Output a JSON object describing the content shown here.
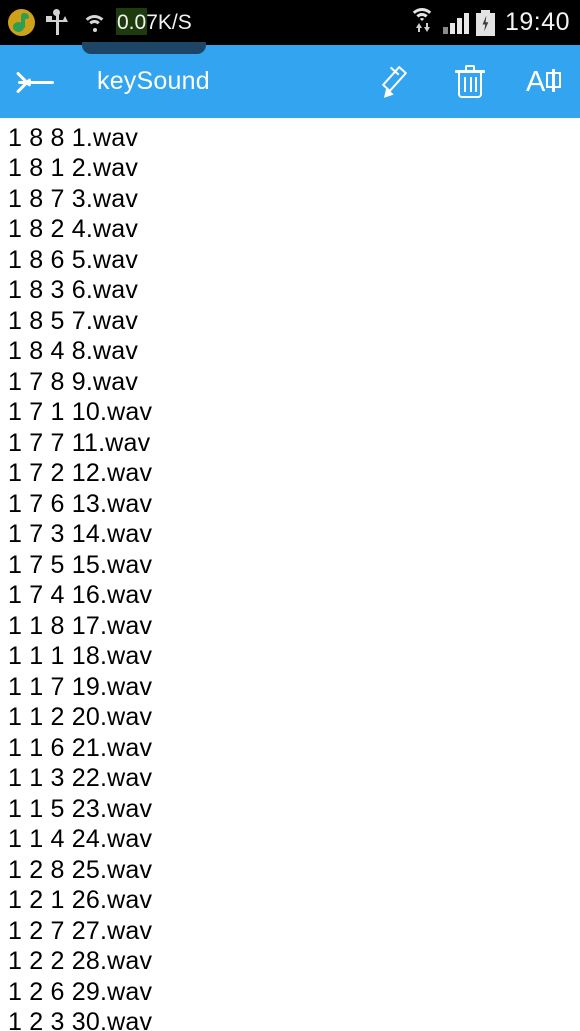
{
  "statusbar": {
    "network_speed": "0.07K/S",
    "clock": "19:40",
    "icons": [
      "music-note-icon",
      "usb-icon",
      "wifi-icon",
      "wifi-transfer-icon",
      "cellular-signal-icon",
      "battery-charging-icon"
    ]
  },
  "appbar": {
    "back_label": "back-arrow-icon",
    "title": "keySound",
    "actions": [
      {
        "name": "edit-icon",
        "label": "Edit"
      },
      {
        "name": "delete-icon",
        "label": "Delete"
      },
      {
        "name": "translate-icon",
        "label": "Translate"
      }
    ]
  },
  "filelist": {
    "rows": [
      "1 8 8 1.wav",
      "1 8 1 2.wav",
      "1 8 7 3.wav",
      "1 8 2 4.wav",
      "1 8 6 5.wav",
      "1 8 3 6.wav",
      "1 8 5 7.wav",
      "1 8 4 8.wav",
      "1 7 8 9.wav",
      "1 7 1 10.wav",
      "1 7 7 11.wav",
      "1 7 2 12.wav",
      "1 7 6 13.wav",
      "1 7 3 14.wav",
      "1 7 5 15.wav",
      "1 7 4 16.wav",
      "1 1 8 17.wav",
      "1 1 1 18.wav",
      "1 1 7 19.wav",
      "1 1 2 20.wav",
      "1 1 6 21.wav",
      "1 1 3 22.wav",
      "1 1 5 23.wav",
      "1 1 4 24.wav",
      "1 2 8 25.wav",
      "1 2 1 26.wav",
      "1 2 7 27.wav",
      "1 2 2 28.wav",
      "1 2 6 29.wav",
      "1 2 3 30.wav"
    ]
  },
  "colors": {
    "appbar_blue": "#33a4f0",
    "statusbar_black": "#000000",
    "speed_highlight_green": "#1d3b0d",
    "text_black": "#000000"
  }
}
